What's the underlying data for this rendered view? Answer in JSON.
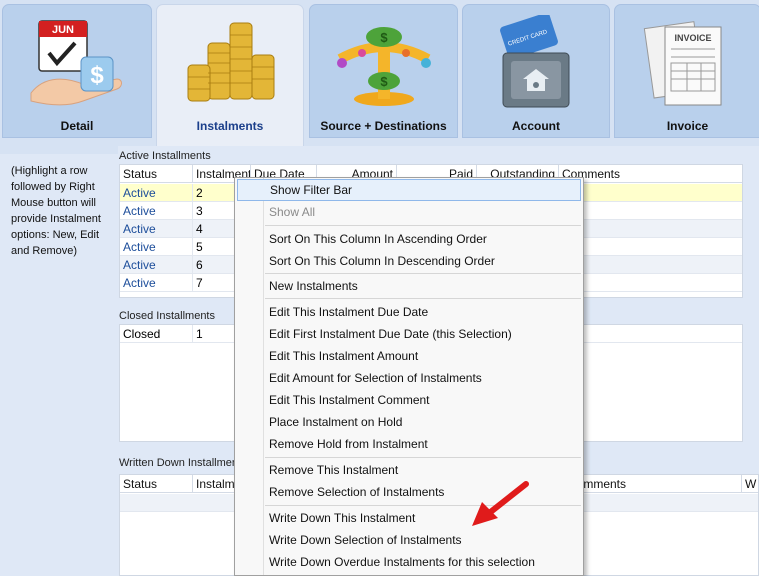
{
  "tabs": [
    {
      "label": "Detail",
      "icon": "calendar-hand-dollar-icon",
      "month": "JUN",
      "active": false
    },
    {
      "label": "Instalments",
      "icon": "coin-stacks-icon",
      "active": true
    },
    {
      "label": "Source + Destinations",
      "icon": "money-scale-icon",
      "active": false
    },
    {
      "label": "Account",
      "icon": "credit-card-safe-icon",
      "card_text": "CREDIT CARD",
      "active": false
    },
    {
      "label": "Invoice",
      "icon": "invoice-papers-icon",
      "invoice_text": "INVOICE",
      "active": false
    }
  ],
  "help_text": "(Highlight a row followed by Right Mouse button will provide Instalment options: New, Edit and Remove)",
  "active_section": {
    "title": "Active Installments",
    "columns": [
      "Status",
      "Instalment",
      "Due Date",
      "Amount",
      "Paid",
      "Outstanding",
      "Comments"
    ],
    "rows": [
      {
        "status": "Active",
        "instalment": "2"
      },
      {
        "status": "Active",
        "instalment": "3"
      },
      {
        "status": "Active",
        "instalment": "4"
      },
      {
        "status": "Active",
        "instalment": "5"
      },
      {
        "status": "Active",
        "instalment": "6"
      },
      {
        "status": "Active",
        "instalment": "7"
      }
    ]
  },
  "closed_section": {
    "title": "Closed Installments",
    "rows": [
      {
        "status": "Closed",
        "instalment": "1"
      }
    ]
  },
  "written_section": {
    "title": "Written Down Installments",
    "columns": [
      "Status",
      "Instalment",
      "Comments",
      "W"
    ]
  },
  "context_menu": {
    "items": [
      {
        "label": "Show Filter Bar",
        "state": "highlighted"
      },
      {
        "label": "Show All",
        "state": "disabled"
      },
      {
        "label": "Sort On This Column In Ascending Order"
      },
      {
        "label": "Sort On This Column In Descending Order"
      },
      {
        "label": "New Instalments"
      },
      {
        "label": "Edit This Instalment Due Date"
      },
      {
        "label": "Edit First Instalment Due Date (this Selection)"
      },
      {
        "label": "Edit This Instalment Amount"
      },
      {
        "label": "Edit Amount for Selection of Instalments"
      },
      {
        "label": "Edit This Instalment Comment"
      },
      {
        "label": "Place Instalment on Hold"
      },
      {
        "label": "Remove Hold from Instalment"
      },
      {
        "label": "Remove This Instalment"
      },
      {
        "label": "Remove Selection of Instalments"
      },
      {
        "label": "Write Down This Instalment"
      },
      {
        "label": "Write Down Selection of Instalments"
      },
      {
        "label": "Write Down Overdue Instalments for this selection"
      }
    ]
  },
  "colors": {
    "accent": "#1b3f8b",
    "active_status": "#1c4d9a",
    "selected_row": "#ffffcc",
    "menu_highlight": "#e6f0fb",
    "arrow": "#e01b1b"
  }
}
